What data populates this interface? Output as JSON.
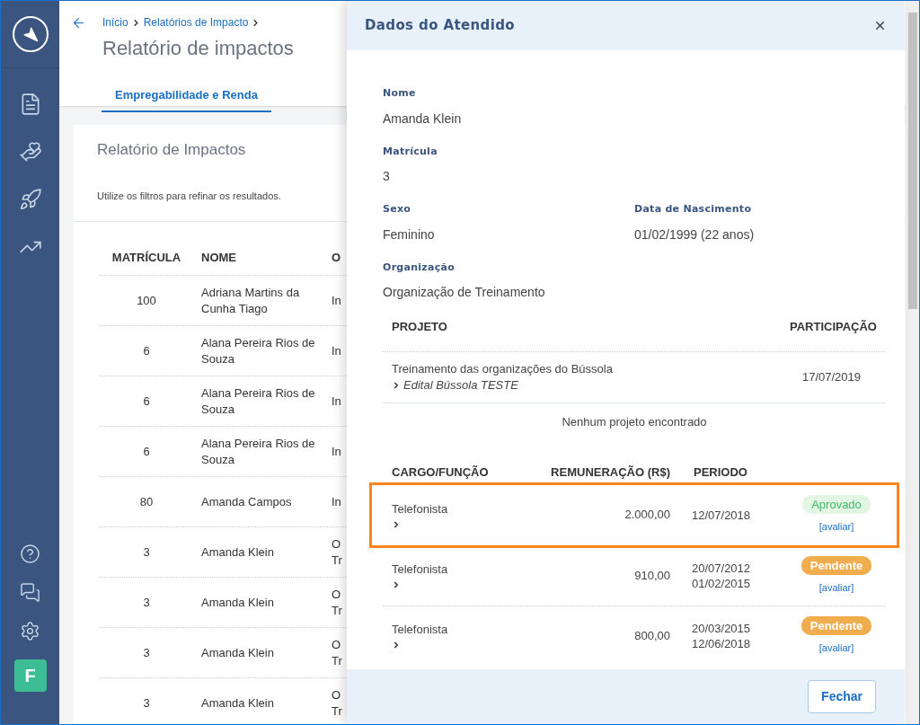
{
  "breadcrumb": [
    {
      "label": "Início"
    },
    {
      "label": "Relatórios de Impacto"
    }
  ],
  "page_title": "Relatório de impactos",
  "tabs": [
    {
      "label": "Empregabilidade e Renda",
      "selected": true
    }
  ],
  "card": {
    "title": "Relatório de Impactos",
    "hint": "Utilize os filtros para refinar os resultados.",
    "columns": [
      "MATRÍCULA",
      "NOME",
      "O"
    ],
    "rows": [
      {
        "matricula": "100",
        "nome": "Adriana Martins da Cunha Tiago",
        "column_3": [
          "In"
        ]
      },
      {
        "matricula": "6",
        "nome": "Alana Pereira Rios de Souza",
        "column_3": [
          "In"
        ]
      },
      {
        "matricula": "6",
        "nome": "Alana Pereira Rios de Souza",
        "column_3": [
          "In"
        ]
      },
      {
        "matricula": "6",
        "nome": "Alana Pereira Rios de Souza",
        "column_3": [
          "In"
        ]
      },
      {
        "matricula": "80",
        "nome": "Amanda Campos",
        "column_3": [
          "In"
        ]
      },
      {
        "matricula": "3",
        "nome": "Amanda Klein",
        "column_3": [
          "O",
          "Tr"
        ]
      },
      {
        "matricula": "3",
        "nome": "Amanda Klein",
        "column_3": [
          "O",
          "Tr"
        ]
      },
      {
        "matricula": "3",
        "nome": "Amanda Klein",
        "column_3": [
          "O",
          "Tr"
        ]
      },
      {
        "matricula": "3",
        "nome": "Amanda Klein",
        "column_3": [
          "O",
          "Tr"
        ]
      }
    ]
  },
  "user_avatar": "F",
  "modal": {
    "title": "Dados do Atendido",
    "field_rows": [
      [
        {
          "label": "Nome",
          "value": "Amanda Klein"
        }
      ],
      [
        {
          "label": "Matrícula",
          "value": "3"
        }
      ],
      [
        {
          "label": "Sexo",
          "value": "Feminino"
        },
        {
          "label": "Data de Nascimento",
          "value": "01/02/1999 (22 anos)"
        }
      ],
      [
        {
          "label": "Organização",
          "value": "Organização de Treinamento"
        }
      ]
    ],
    "projects": {
      "columns": [
        "PROJETO",
        "PARTICIPAÇÃO"
      ],
      "rows": [
        {
          "name": "Treinamento das organizações do Bússola",
          "edital": "Edital Bússola TESTE",
          "date": "17/07/2019"
        }
      ],
      "empty_message": "Nenhum projeto encontrado"
    },
    "jobs": {
      "columns": [
        "CARGO/FUNÇÃO",
        "REMUNERAÇÃO (R$)",
        "PERIODO"
      ],
      "rows": [
        {
          "cargo": "Telefonista",
          "remuneracao": "2.000,00",
          "periodo": [
            "12/07/2018"
          ],
          "status": {
            "kind": "approved",
            "label": "Aprovado"
          },
          "link": "[avaliar]",
          "highlighted": true
        },
        {
          "cargo": "Telefonista",
          "remuneracao": "910,00",
          "periodo": [
            "20/07/2012",
            "01/02/2015"
          ],
          "status": {
            "kind": "pending",
            "label": "Pendente"
          },
          "link": "[avaliar]",
          "highlighted": false
        },
        {
          "cargo": "Telefonista",
          "remuneracao": "800,00",
          "periodo": [
            "20/03/2015",
            "12/06/2018"
          ],
          "status": {
            "kind": "pending",
            "label": "Pendente"
          },
          "link": "[avaliar]",
          "highlighted": false
        }
      ]
    },
    "buttons": [
      "Fechar"
    ]
  }
}
